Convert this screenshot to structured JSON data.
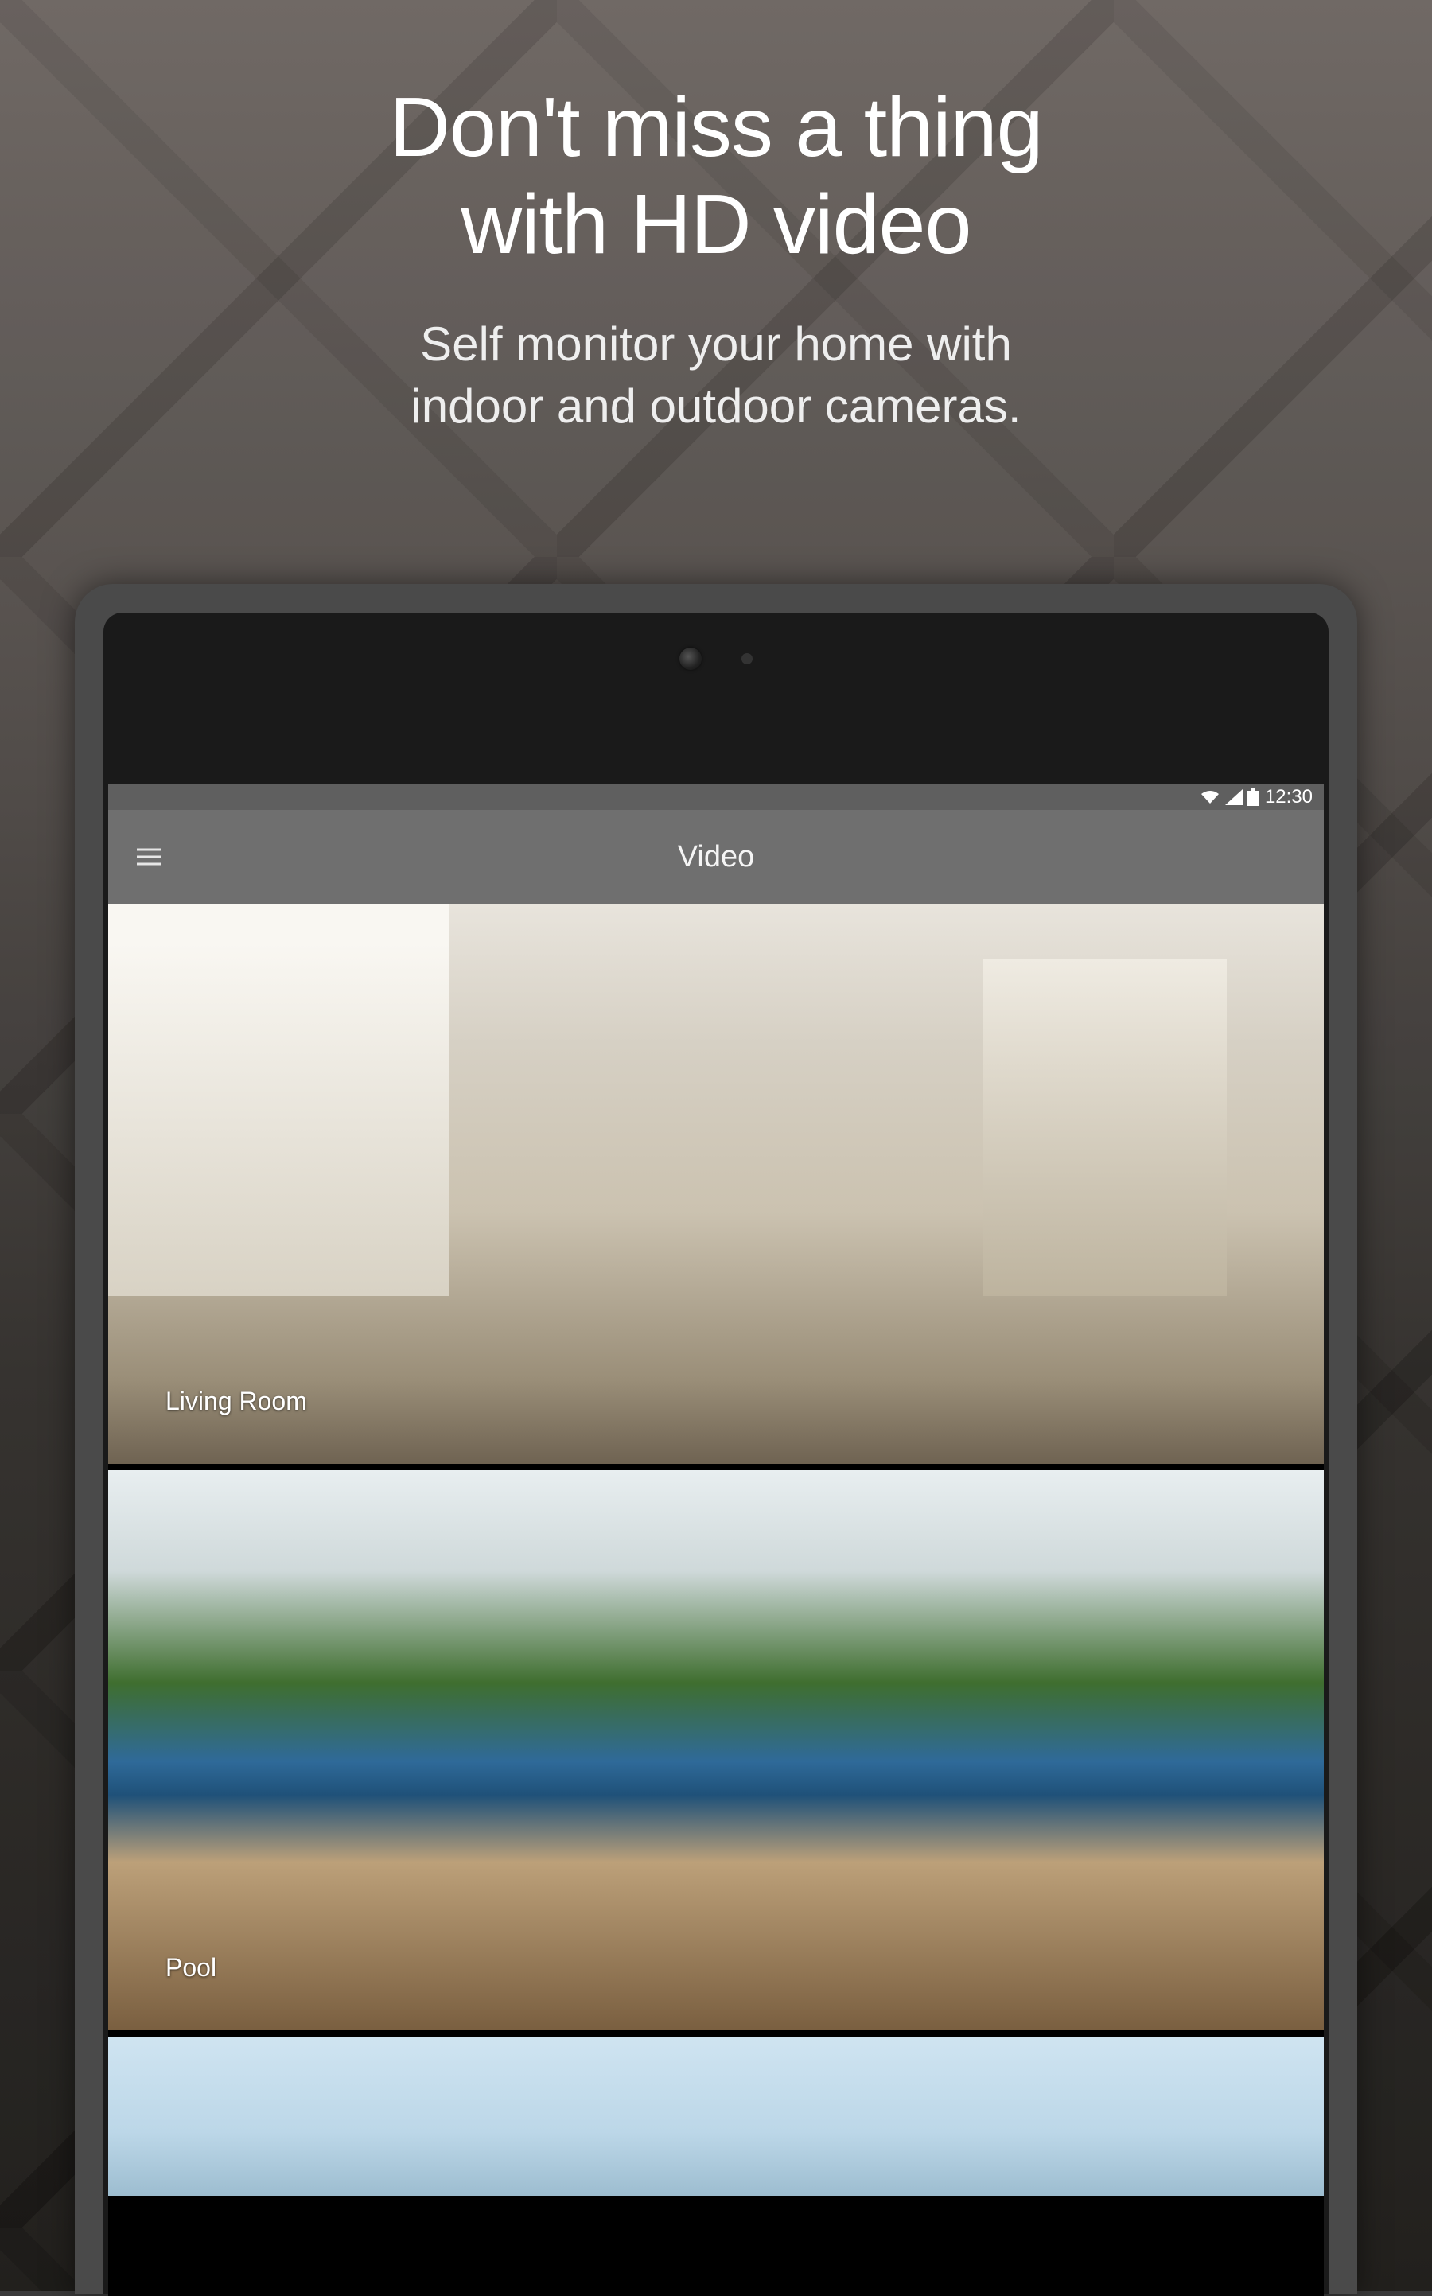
{
  "hero": {
    "title_line1": "Don't miss a thing",
    "title_line2": "with HD video",
    "subtitle_line1": "Self monitor your home with",
    "subtitle_line2": "indoor and outdoor cameras."
  },
  "status_bar": {
    "time": "12:30",
    "icons": {
      "wifi": "wifi-icon",
      "signal": "signal-icon",
      "battery": "battery-icon"
    }
  },
  "app_bar": {
    "title": "Video",
    "menu": "menu-icon"
  },
  "cameras": [
    {
      "label": "Living Room"
    },
    {
      "label": "Pool"
    },
    {
      "label": ""
    }
  ]
}
